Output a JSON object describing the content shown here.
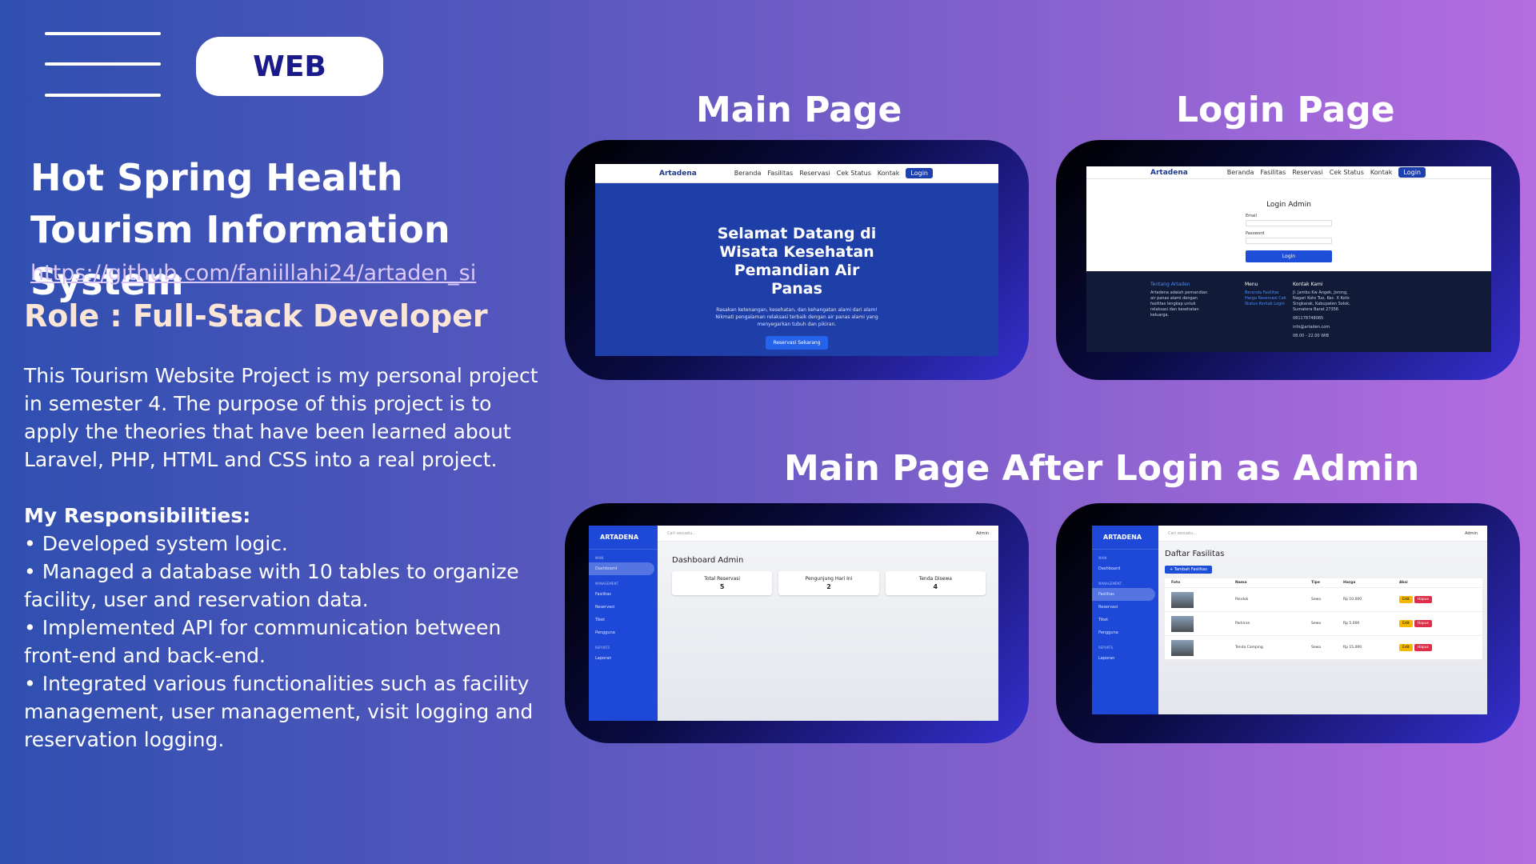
{
  "tag": "WEB",
  "project": {
    "title": "Hot Spring Health Tourism Information System",
    "link": "https://github.com/faniillahi24/artaden_si",
    "role": "Role : Full-Stack Developer",
    "description": "This Tourism Website Project is my personal project in semester 4. The purpose of this project is to apply the theories that have been learned about Laravel, PHP, HTML and CSS into a real project.",
    "responsibilities_title": "My Responsibilities:",
    "responsibilities": [
      "• Developed system logic.",
      "• Managed a database with 10 tables to organize facility, user and reservation data.",
      "• Implemented API for communication between front-end and back-end.",
      "• Integrated various functionalities such as facility management, user management, visit logging and reservation logging."
    ]
  },
  "headings": {
    "main": "Main Page",
    "login": "Login Page",
    "admin": "Main Page After Login as Admin"
  },
  "site": {
    "logo": "Artadena",
    "nav": [
      "Beranda",
      "Fasilitas",
      "Reservasi",
      "Cek Status",
      "Kontak"
    ],
    "login_btn": "Login",
    "hero_title": "Selamat Datang di Wisata Kesehatan Pemandian Air Panas",
    "hero_text": "Rasakan ketenangan, kesehatan, dan kehangatan alami dari alam! Nikmati pengalaman relaksasi terbaik dengan air panas alami yang menyegarkan tubuh dan pikiran.",
    "hero_btn": "Reservasi Sekarang"
  },
  "login": {
    "title": "Login Admin",
    "email_label": "Email",
    "password_label": "Password",
    "button": "Login",
    "footer": {
      "about_title": "Tentang Artaden",
      "about_text": "Artadena adalah pemandian air panas alami dengan fasilitas lengkap untuk relaksasi dan kesehatan keluarga.",
      "menu_title": "Menu",
      "menu_items": [
        "Beranda Fasilitas",
        "Harga Reservasi Cek",
        "Status Kontak Login"
      ],
      "contact_title": "Kontak Kami",
      "address": "Jl. Jambu Kw Angek, Jorong, Nagari Koto Tuo, Kec. X Koto Singkarak, Kabupaten Solok, Sumatera Barat 27356",
      "phone": "081178748085",
      "email": "info@artaden.com",
      "hours": "08.00 - 22.00 WIB"
    }
  },
  "admin": {
    "brand": "ARTADENA",
    "search_placeholder": "Cari sesuatu...",
    "user": "Admin",
    "menu_section_main": "MAIN",
    "menu_section_mgmt": "MANAGEMENT",
    "menu_section_reports": "REPORTS",
    "menu_dashboard": "Dashboard",
    "menu_facilities": "Fasilitas",
    "menu_reservations": "Reservasi",
    "menu_tickets": "Tiket",
    "menu_users": "Pengguna",
    "menu_reports": "Laporan",
    "dashboard_title": "Dashboard Admin",
    "cards": [
      {
        "label": "Total Reservasi",
        "value": "5"
      },
      {
        "label": "Pengunjung Hari Ini",
        "value": "2"
      },
      {
        "label": "Tenda Disewa",
        "value": "4"
      }
    ],
    "facility_title": "Daftar Fasilitas",
    "add_button": "+ Tambah Fasilitas",
    "columns": [
      "Foto",
      "Nama",
      "Tipe",
      "Harga",
      "Aksi"
    ],
    "rows": [
      {
        "nama": "Pondok",
        "tipe": "Sewa",
        "harga": "Rp 10.000"
      },
      {
        "nama": "Parkiran",
        "tipe": "Sewa",
        "harga": "Rp 5.000"
      },
      {
        "nama": "Tenda Camping",
        "tipe": "Sewa",
        "harga": "Rp 15.000"
      }
    ],
    "edit": "Edit",
    "delete": "Hapus"
  }
}
